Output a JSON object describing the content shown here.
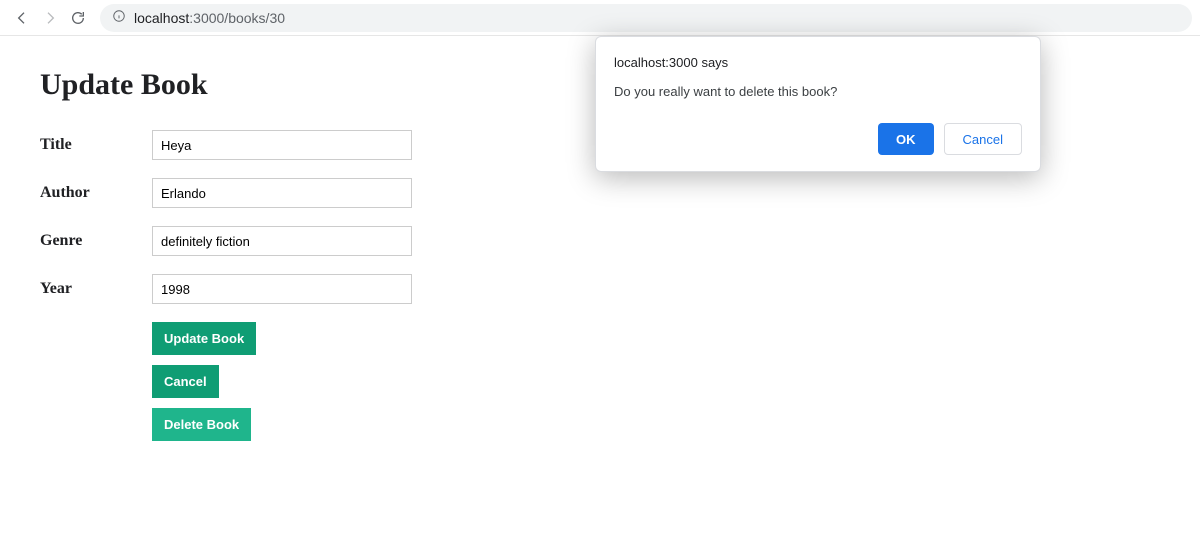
{
  "browser": {
    "url_host": "localhost",
    "url_rest": ":3000/books/30"
  },
  "page": {
    "heading": "Update Book",
    "fields": {
      "title": {
        "label": "Title",
        "value": "Heya"
      },
      "author": {
        "label": "Author",
        "value": "Erlando"
      },
      "genre": {
        "label": "Genre",
        "value": "definitely fiction"
      },
      "year": {
        "label": "Year",
        "value": "1998"
      }
    },
    "buttons": {
      "update": "Update Book",
      "cancel": "Cancel",
      "delete": "Delete Book"
    }
  },
  "dialog": {
    "origin": "localhost:3000 says",
    "message": "Do you really want to delete this book?",
    "ok_label": "OK",
    "cancel_label": "Cancel"
  }
}
